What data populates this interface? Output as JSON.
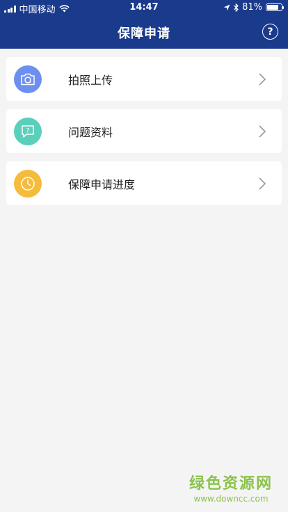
{
  "status_bar": {
    "carrier": "中国移动",
    "time": "14:47",
    "battery_percent": "81%",
    "battery_level": 0.81
  },
  "header": {
    "title": "保障申请",
    "help_icon_text": "?"
  },
  "menu": [
    {
      "label": "拍照上传",
      "icon": "camera-icon",
      "color": "#6d8ff0"
    },
    {
      "label": "问题资料",
      "icon": "chat-question-icon",
      "color": "#5bcfba"
    },
    {
      "label": "保障申请进度",
      "icon": "clock-icon",
      "color": "#f5bb3c"
    }
  ],
  "watermark": {
    "main": "绿色资源网",
    "url": "www.downcc.com"
  }
}
